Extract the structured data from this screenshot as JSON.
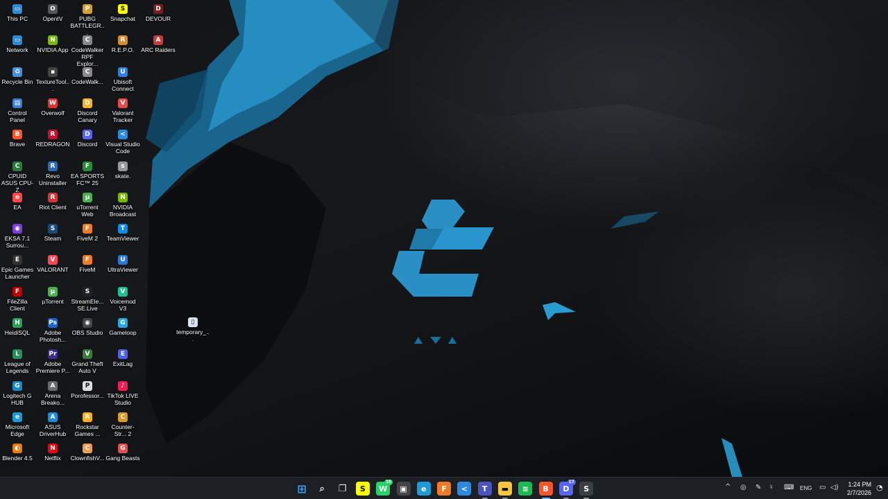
{
  "desktop": {
    "icons": [
      {
        "label": "This PC",
        "glyph": "▭",
        "color": "#2f8ad3"
      },
      {
        "label": "Network",
        "glyph": "▭",
        "color": "#2f8ad3"
      },
      {
        "label": "Recycle Bin",
        "glyph": "♻",
        "color": "#4a90d9"
      },
      {
        "label": "Control Panel",
        "glyph": "▤",
        "color": "#3b7fd0"
      },
      {
        "label": "Brave",
        "glyph": "B",
        "color": "#fb542b"
      },
      {
        "label": "CPUID ASUS CPU-Z",
        "glyph": "C",
        "color": "#2c7a3f"
      },
      {
        "label": "EA",
        "glyph": "e",
        "color": "#ff4747"
      },
      {
        "label": "EKSA 7.1 Surrou...",
        "glyph": "◉",
        "color": "#7b3fd6"
      },
      {
        "label": "Epic Games Launcher",
        "glyph": "E",
        "color": "#333"
      },
      {
        "label": "FileZilla Client",
        "glyph": "F",
        "color": "#bf0000"
      },
      {
        "label": "HeidiSQL",
        "glyph": "H",
        "color": "#2e9e57"
      },
      {
        "label": "League of Legends",
        "glyph": "L",
        "color": "#2a8c5a"
      },
      {
        "label": "Logitech G HUB",
        "glyph": "G",
        "color": "#1e88c7"
      },
      {
        "label": "Microsoft Edge",
        "glyph": "e",
        "color": "#1e9ad6"
      },
      {
        "label": "Blender 4.5",
        "glyph": "◐",
        "color": "#e87d0d"
      },
      {
        "label": "OpenIV",
        "glyph": "O",
        "color": "#555"
      },
      {
        "label": "NVIDIA App",
        "glyph": "N",
        "color": "#76b900"
      },
      {
        "label": "TextureTool...",
        "glyph": "▪",
        "color": "#444"
      },
      {
        "label": "Overwolf",
        "glyph": "W",
        "color": "#d33"
      },
      {
        "label": "REDRAGON",
        "glyph": "R",
        "color": "#c8102e"
      },
      {
        "label": "Revo Uninstaller",
        "glyph": "R",
        "color": "#2a6bb8"
      },
      {
        "label": "Riot Client",
        "glyph": "R",
        "color": "#d13639"
      },
      {
        "label": "Steam",
        "glyph": "S",
        "color": "#1b4a7a"
      },
      {
        "label": "VALORANT",
        "glyph": "V",
        "color": "#ff4655"
      },
      {
        "label": "µTorrent",
        "glyph": "µ",
        "color": "#4caf50"
      },
      {
        "label": "Adobe Photosh...",
        "glyph": "Ps",
        "color": "#1e64c8"
      },
      {
        "label": "Adobe Premiere P...",
        "glyph": "Pr",
        "color": "#3b2a8c"
      },
      {
        "label": "Arena Breako...",
        "glyph": "A",
        "color": "#6a6a6a"
      },
      {
        "label": "ASUS DriverHub",
        "glyph": "A",
        "color": "#1a8fd8"
      },
      {
        "label": "Netflix",
        "glyph": "N",
        "color": "#e50914"
      },
      {
        "label": "PUBG BATTLEGR...",
        "glyph": "P",
        "color": "#d69e2e"
      },
      {
        "label": "CodeWalker RPF Explor...",
        "glyph": "C",
        "color": "#888"
      },
      {
        "label": "CodeWalk...",
        "glyph": "C",
        "color": "#888"
      },
      {
        "label": "Discord Canary",
        "glyph": "D",
        "color": "#f4b32a"
      },
      {
        "label": "Discord",
        "glyph": "D",
        "color": "#5865f2"
      },
      {
        "label": "EA SPORTS FC™ 25",
        "glyph": "F",
        "color": "#2a8c3a"
      },
      {
        "label": "uTorrent Web",
        "glyph": "µ",
        "color": "#4caf50"
      },
      {
        "label": "FiveM 2",
        "glyph": "F",
        "color": "#f07a27"
      },
      {
        "label": "FiveM",
        "glyph": "F",
        "color": "#f07a27"
      },
      {
        "label": "StreamEle... SE.Live",
        "glyph": "S",
        "color": "#222"
      },
      {
        "label": "OBS Studio",
        "glyph": "◉",
        "color": "#444"
      },
      {
        "label": "Grand Theft Auto V",
        "glyph": "V",
        "color": "#3a7a3a"
      },
      {
        "label": "Porofessor...",
        "glyph": "P",
        "color": "#ddd"
      },
      {
        "label": "Rockstar Games ...",
        "glyph": "R",
        "color": "#fcaf17"
      },
      {
        "label": "ClownfishV...",
        "glyph": "C",
        "color": "#f29b55"
      },
      {
        "label": "Snapchat",
        "glyph": "S",
        "color": "#fffc00"
      },
      {
        "label": "R.E.P.O.",
        "glyph": "R",
        "color": "#d98a2b"
      },
      {
        "label": "Ubisoft Connect",
        "glyph": "U",
        "color": "#2f7fe0"
      },
      {
        "label": "Valorant Tracker",
        "glyph": "V",
        "color": "#e64a4a"
      },
      {
        "label": "Visual Studio Code",
        "glyph": "<",
        "color": "#2b8ae0"
      },
      {
        "label": "skate.",
        "glyph": "s",
        "color": "#999"
      },
      {
        "label": "NVIDIA Broadcast",
        "glyph": "N",
        "color": "#76b900"
      },
      {
        "label": "TeamViewer",
        "glyph": "T",
        "color": "#0e8ee9"
      },
      {
        "label": "UltraViewer",
        "glyph": "U",
        "color": "#2a79d8"
      },
      {
        "label": "Voicemod V3",
        "glyph": "V",
        "color": "#1fbf8f"
      },
      {
        "label": "Gameloop",
        "glyph": "G",
        "color": "#28a6e0"
      },
      {
        "label": "ExitLag",
        "glyph": "E",
        "color": "#4b61e8"
      },
      {
        "label": "TikTok LIVE Studio",
        "glyph": "♪",
        "color": "#ee1d52"
      },
      {
        "label": "Counter-Str... 2",
        "glyph": "C",
        "color": "#d89a2b"
      },
      {
        "label": "Gang Beasts",
        "glyph": "G",
        "color": "#e05050"
      },
      {
        "label": "DEVOUR",
        "glyph": "D",
        "color": "#7a1f1f"
      },
      {
        "label": "ARC Raiders",
        "glyph": "A",
        "color": "#c43b3b"
      },
      {
        "label": "temporary_...",
        "glyph": "▯",
        "color": "#d9e4f0"
      }
    ]
  },
  "taskbar": {
    "apps": [
      {
        "name": "start-icon",
        "glyph": "⊞",
        "color": "#3aa0ff"
      },
      {
        "name": "search-icon",
        "glyph": "⌕",
        "color": "transparent"
      },
      {
        "name": "task-view-icon",
        "glyph": "❐",
        "color": "transparent"
      },
      {
        "name": "snapchat-icon",
        "glyph": "S",
        "color": "#fffc00"
      },
      {
        "name": "whatsapp-icon",
        "glyph": "W",
        "color": "#25d366"
      },
      {
        "name": "store-icon",
        "glyph": "▣",
        "color": "#444"
      },
      {
        "name": "edge-icon",
        "glyph": "e",
        "color": "#1e9ad6"
      },
      {
        "name": "fivem-icon",
        "glyph": "F",
        "color": "#f07a27"
      },
      {
        "name": "vscode-icon",
        "glyph": "<",
        "color": "#2b8ae0"
      },
      {
        "name": "teams-icon",
        "glyph": "T",
        "color": "#4b53bc"
      },
      {
        "name": "file-explorer-icon",
        "glyph": "▬",
        "color": "#f4c542"
      },
      {
        "name": "spotify-icon",
        "glyph": "≋",
        "color": "#1db954"
      },
      {
        "name": "brave-icon",
        "glyph": "B",
        "color": "#fb542b"
      },
      {
        "name": "discord-icon",
        "glyph": "D",
        "color": "#5865f2"
      },
      {
        "name": "steam-icon",
        "glyph": "S",
        "color": "#3a3f46"
      }
    ],
    "whatsapp_badge": "10",
    "discord_badge": "17",
    "tray": {
      "language": "ENG",
      "time": "1:24 PM",
      "date": "2/7/2026"
    }
  }
}
